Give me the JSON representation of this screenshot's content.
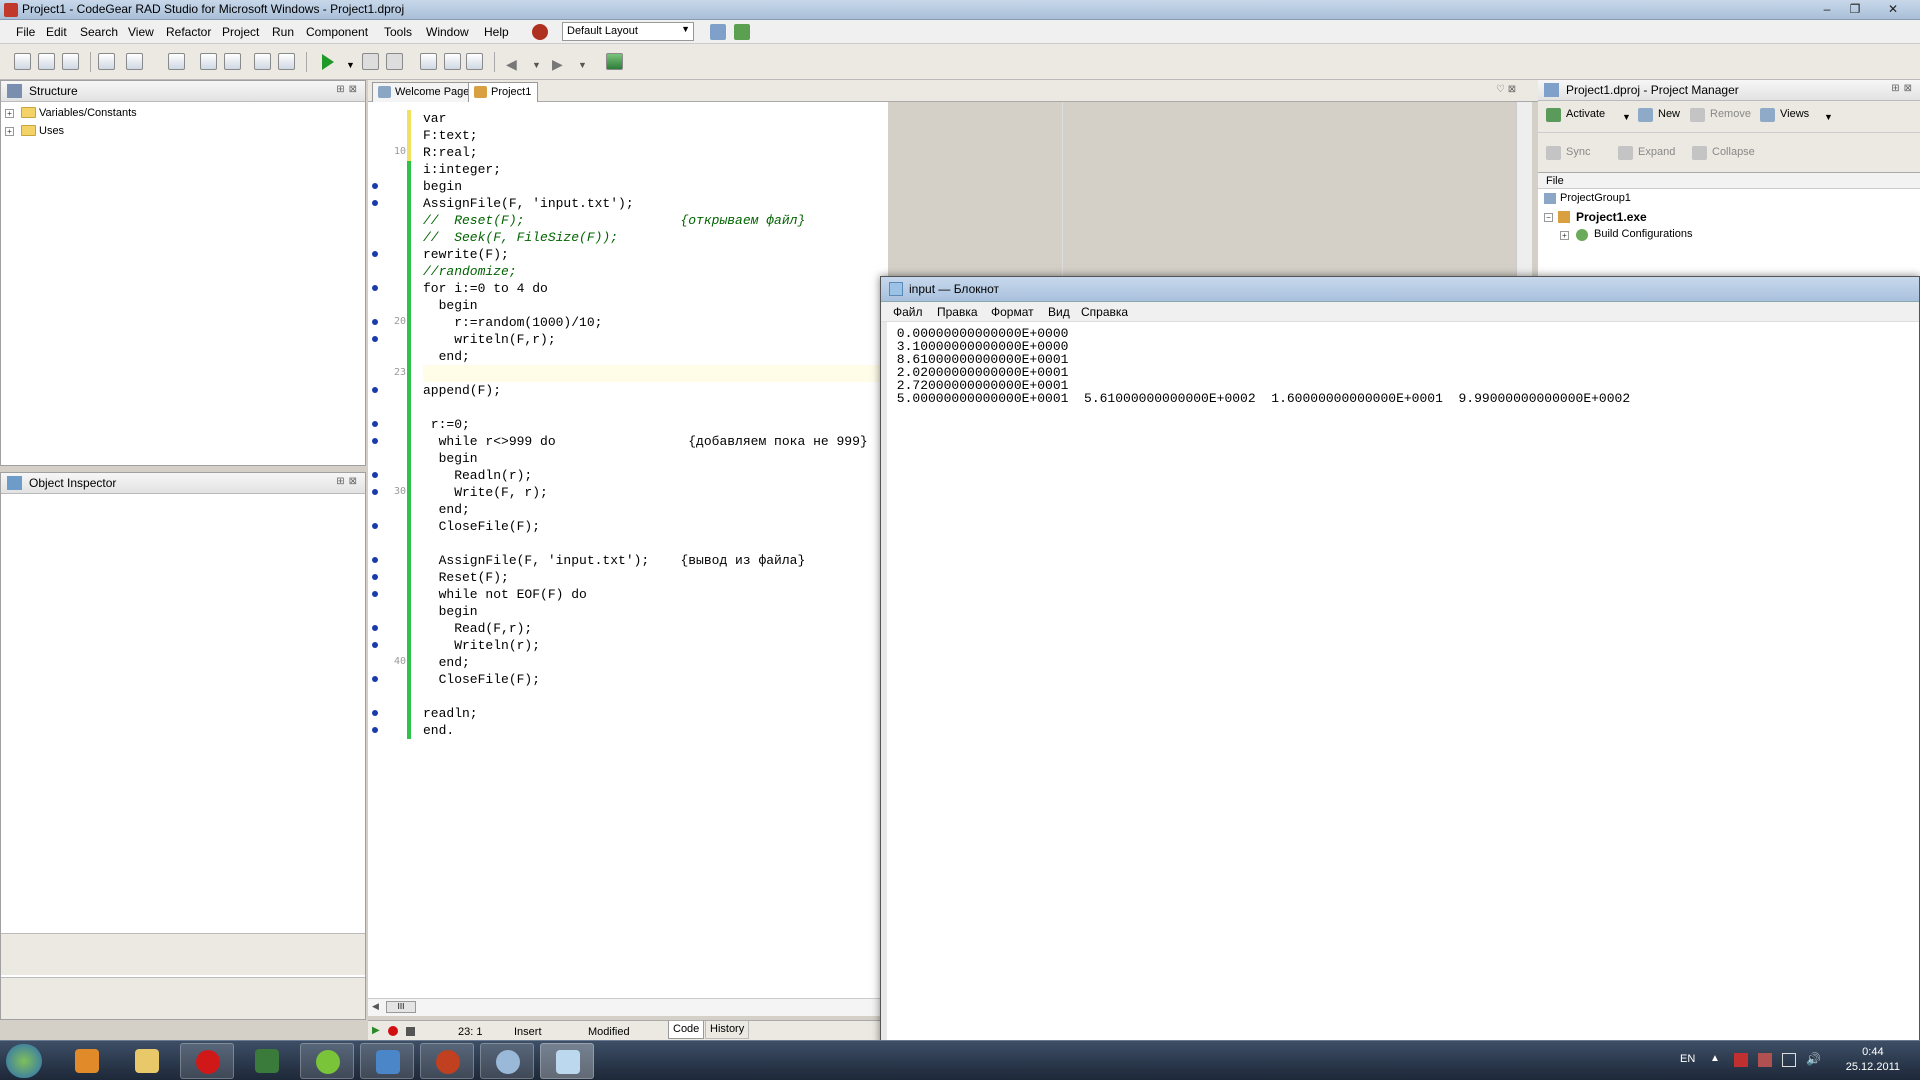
{
  "window": {
    "title": "Project1 - CodeGear RAD Studio for Microsoft Windows - Project1.dproj"
  },
  "menu": [
    "File",
    "Edit",
    "Search",
    "View",
    "Refactor",
    "Project",
    "Run",
    "Component",
    "Tools",
    "Window",
    "Help"
  ],
  "layout_select": "Default Layout",
  "structure": {
    "title": "Structure",
    "items": [
      "Variables/Constants",
      "Uses"
    ]
  },
  "object_inspector": {
    "title": "Object Inspector"
  },
  "editor_tabs": [
    "Welcome Page",
    "Project1"
  ],
  "code_lines": [
    "var",
    "F:text;",
    "R:real;",
    "i:integer;",
    "begin",
    "AssignFile(F, 'input.txt');",
    "//  Reset(F);                    {открываем файл}",
    "//  Seek(F, FileSize(F));",
    "rewrite(F);",
    "//randomize;",
    "for i:=0 to 4 do",
    "  begin",
    "    r:=random(1000)/10;",
    "    writeln(F,r);",
    "  end;",
    "",
    "append(F);",
    "",
    " r:=0;",
    "  while r<>999 do                 {добавляем пока не 999}",
    "  begin",
    "    Readln(r);",
    "    Write(F, r);",
    "  end;",
    "  CloseFile(F);",
    "",
    "  AssignFile(F, 'input.txt');    {вывод из файла}",
    "  Reset(F);",
    "  while not EOF(F) do",
    "  begin",
    "    Read(F,r);",
    "    Writeln(r);",
    "  end;",
    "  CloseFile(F);",
    "",
    "readln;",
    "end."
  ],
  "line_numbers": {
    "1": "10",
    "2": "20",
    "3": "23",
    "4": "30",
    "5": "40"
  },
  "status": {
    "position": "23:  1",
    "mode": "Insert",
    "state": "Modified",
    "tab_code": "Code",
    "tab_history": "History"
  },
  "project_manager": {
    "title": "Project1.dproj - Project Manager",
    "activate": "Activate",
    "new": "New",
    "remove": "Remove",
    "views": "Views",
    "sync": "Sync",
    "expand": "Expand",
    "collapse": "Collapse",
    "col_file": "File",
    "group": "ProjectGroup1",
    "project": "Project1.exe",
    "build": "Build Configurations"
  },
  "notepad": {
    "title": "input — Блокнот",
    "menu": [
      "Файл",
      "Правка",
      "Формат",
      "Вид",
      "Справка"
    ],
    "lines": [
      " 0.00000000000000E+0000",
      " 3.10000000000000E+0000",
      " 8.61000000000000E+0001",
      " 2.02000000000000E+0001",
      " 2.72000000000000E+0001",
      " 5.00000000000000E+0001  5.61000000000000E+0002  1.60000000000000E+0001  9.99000000000000E+0002"
    ]
  },
  "taskbar": {
    "lang": "EN",
    "time": "0:44",
    "date": "25.12.2011"
  }
}
